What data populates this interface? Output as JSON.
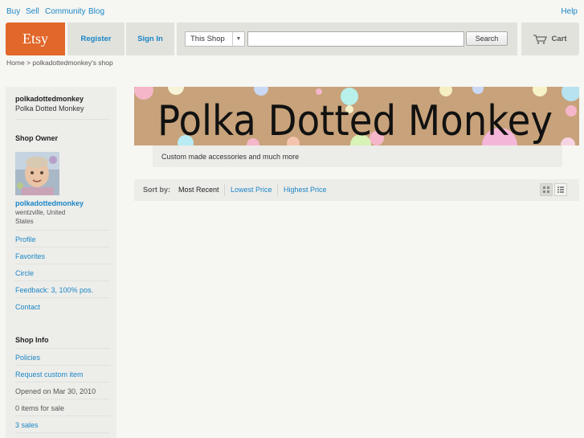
{
  "topnav": {
    "buy": "Buy",
    "sell": "Sell",
    "community": "Community",
    "blog": "Blog",
    "help": "Help"
  },
  "header": {
    "logo": "Etsy",
    "register": "Register",
    "signin": "Sign In",
    "search_scope": "This Shop",
    "search_value": "",
    "search_button": "Search",
    "cart": "Cart"
  },
  "breadcrumb": "Home > polkadottedmonkey's shop",
  "sidebar": {
    "shop_user": "polkadottedmonkey",
    "shop_title": "Polka Dotted Monkey",
    "owner_heading": "Shop Owner",
    "owner_name": "polkadottedmonkey",
    "owner_location_1": "wentzville, United",
    "owner_location_2": "States",
    "owner_links": [
      "Profile",
      "Favorites",
      "Circle",
      "Feedback: 3, 100% pos.",
      "Contact"
    ],
    "info_heading": "Shop Info",
    "info_policies": "Policies",
    "info_request": "Request custom item",
    "info_opened": "Opened on Mar 30, 2010",
    "info_items": "0 items for sale",
    "info_sales": "3 sales"
  },
  "banner": {
    "text": "Polka Dotted Monkey",
    "bg_color": "#c7a27a"
  },
  "tagline": "Custom made accessories and much more",
  "sort": {
    "label": "Sort by:",
    "most_recent": "Most Recent",
    "lowest": "Lowest Price",
    "highest": "Highest Price"
  },
  "icons": {
    "cart": "cart-icon",
    "grid_view": "grid-view-icon",
    "list_view": "list-view-icon"
  },
  "colors": {
    "brand": "#e1672a",
    "link": "#1b86c6"
  }
}
